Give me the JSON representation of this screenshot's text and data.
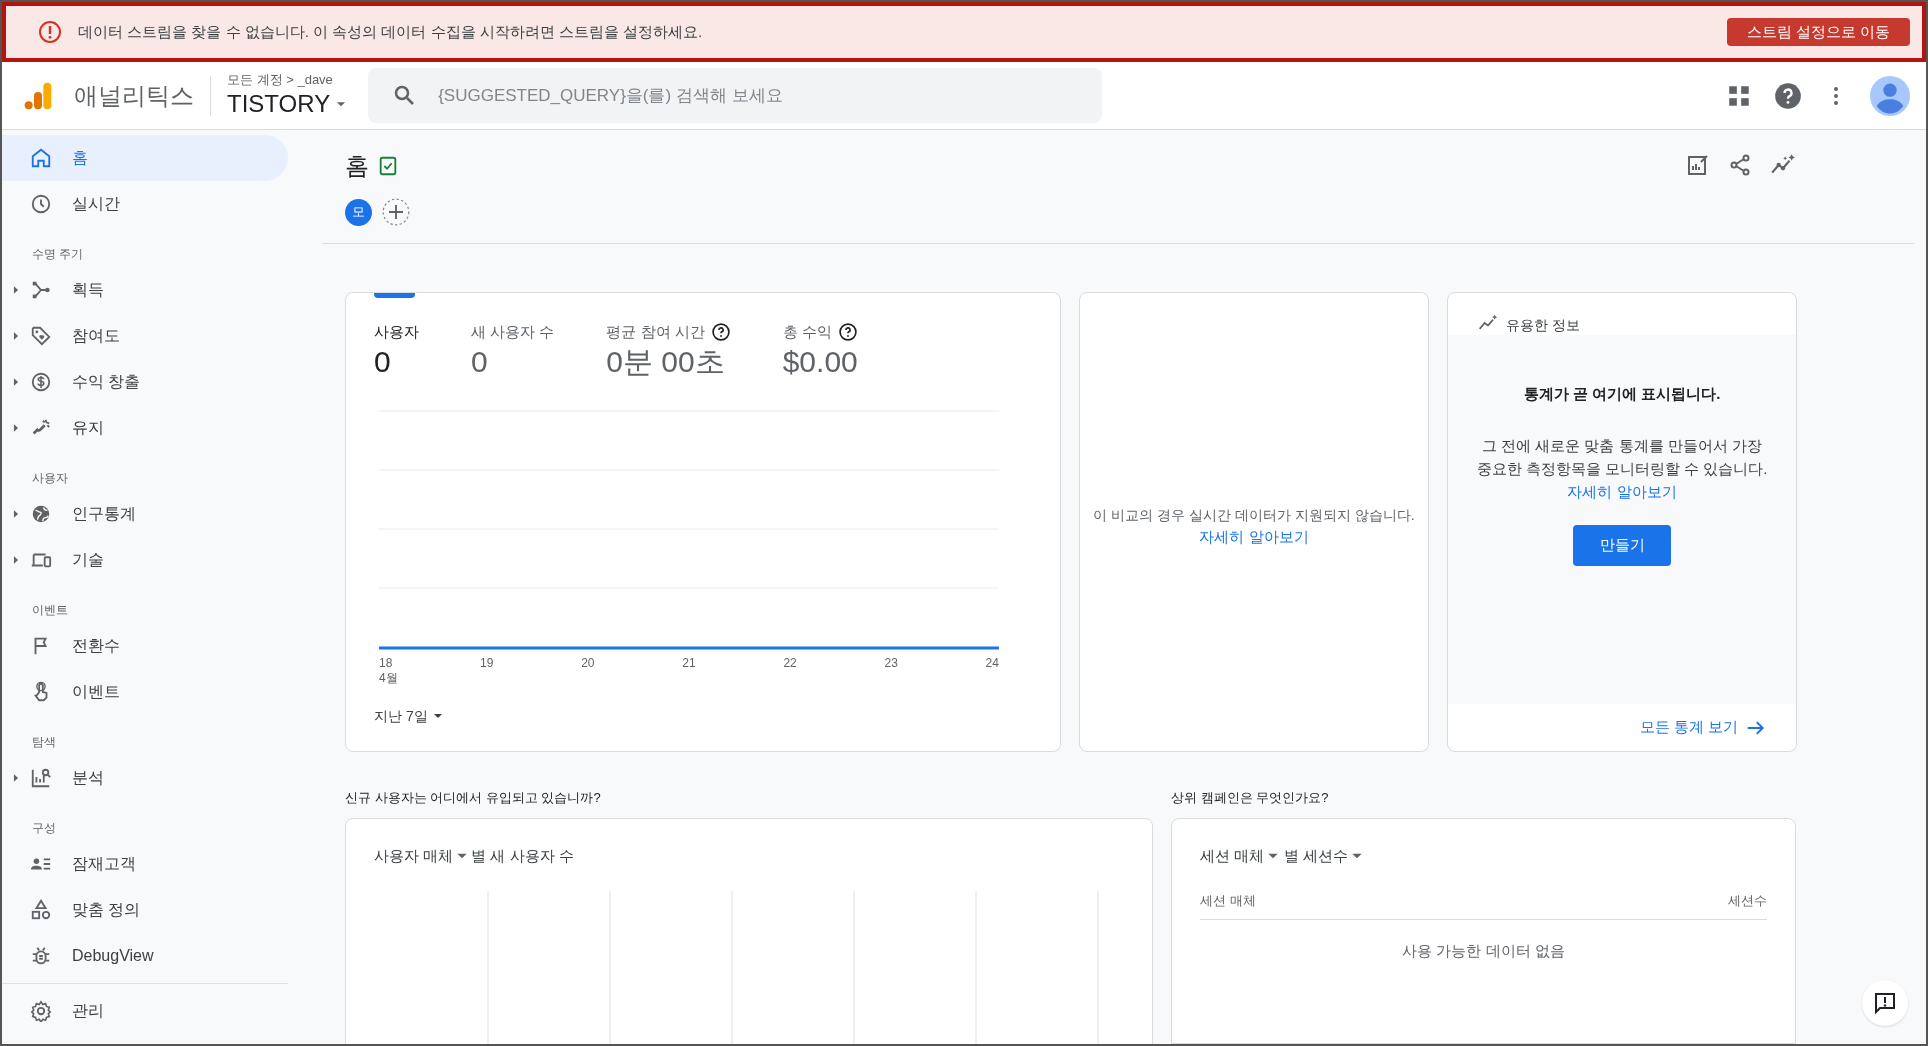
{
  "banner": {
    "message": "데이터 스트림을 찾을 수 없습니다. 이 속성의 데이터 수집을 시작하려면 스트림을 설정하세요.",
    "button": "스트림 설정으로 이동"
  },
  "header": {
    "product": "애널리틱스",
    "breadcrumb": "모든 계정 > _dave",
    "property": "TISTORY",
    "search_placeholder": "{SUGGESTED_QUERY}을(를) 검색해 보세요"
  },
  "sidebar": {
    "sections": [
      {
        "items": [
          {
            "label": "홈",
            "selected": true,
            "expandable": false
          },
          {
            "label": "실시간",
            "selected": false,
            "expandable": false
          }
        ]
      },
      {
        "title": "수명 주기",
        "items": [
          {
            "label": "획득",
            "selected": false,
            "expandable": true
          },
          {
            "label": "참여도",
            "selected": false,
            "expandable": true
          },
          {
            "label": "수익 창출",
            "selected": false,
            "expandable": true
          },
          {
            "label": "유지",
            "selected": false,
            "expandable": true
          }
        ]
      },
      {
        "title": "사용자",
        "items": [
          {
            "label": "인구통계",
            "selected": false,
            "expandable": true
          },
          {
            "label": "기술",
            "selected": false,
            "expandable": true
          }
        ]
      },
      {
        "title": "이벤트",
        "items": [
          {
            "label": "전환수",
            "selected": false,
            "expandable": false
          },
          {
            "label": "이벤트",
            "selected": false,
            "expandable": false
          }
        ]
      },
      {
        "title": "탐색",
        "items": [
          {
            "label": "분석",
            "selected": false,
            "expandable": true
          }
        ]
      },
      {
        "title": "구성",
        "items": [
          {
            "label": "잠재고객",
            "selected": false,
            "expandable": false
          },
          {
            "label": "맞춤 정의",
            "selected": false,
            "expandable": false
          },
          {
            "label": "DebugView",
            "selected": false,
            "expandable": false
          }
        ]
      }
    ],
    "footer": {
      "label": "관리",
      "selected": false
    }
  },
  "page": {
    "title": "홈",
    "comparison_chip": "모"
  },
  "overview": {
    "metrics": [
      {
        "label": "사용자",
        "value": "0",
        "help": false,
        "selected": true
      },
      {
        "label": "새 사용자 수",
        "value": "0",
        "help": false,
        "selected": false
      },
      {
        "label": "평균 참여 시간",
        "value": "0분 00초",
        "help": true,
        "selected": false
      },
      {
        "label": "총 수익",
        "value": "$0.00",
        "help": true,
        "selected": false
      }
    ],
    "x_labels": [
      "18",
      "19",
      "20",
      "21",
      "22",
      "23",
      "24"
    ],
    "month_label": "4월",
    "date_range": "지난 7일"
  },
  "realtime": {
    "message": "이 비교의 경우 실시간 데이터가 지원되지 않습니다.",
    "link": "자세히 알아보기"
  },
  "insights": {
    "title": "유용한 정보",
    "heading": "통계가 곧 여기에 표시됩니다.",
    "body": "그 전에 새로운 맞춤 통계를 만들어서 가장 중요한 측정항목을 모니터링할 수 있습니다.",
    "link": "자세히 알아보기",
    "button": "만들기",
    "footer_link": "모든 통계 보기"
  },
  "new_users": {
    "question": "신규 사용자는 어디에서 유입되고 있습니까?",
    "dimension": "사용자 매체",
    "metric": "별 새 사용자 수"
  },
  "campaigns": {
    "question": "상위 캠페인은 무엇인가요?",
    "dimension": "세션 매체",
    "metric": "별 세션수",
    "columns": [
      "세션 매체",
      "세션수"
    ],
    "empty": "사용 가능한 데이터 없음"
  }
}
